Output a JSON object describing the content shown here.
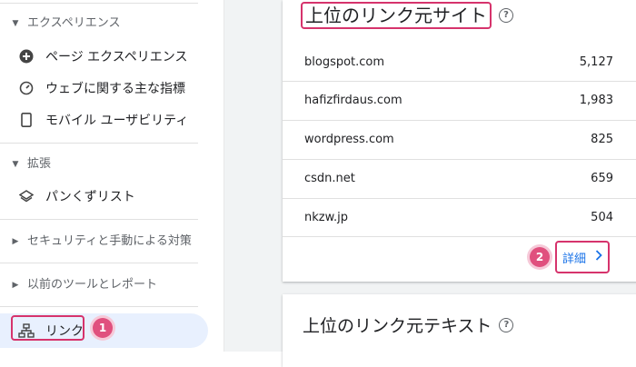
{
  "sidebar": {
    "experience": {
      "header": "エクスペリエンス",
      "items": [
        {
          "label": "ページ エクスペリエンス",
          "icon": "plus-circle-icon"
        },
        {
          "label": "ウェブに関する主な指標",
          "icon": "gauge-icon"
        },
        {
          "label": "モバイル ユーザビリティ",
          "icon": "smartphone-icon"
        }
      ]
    },
    "enhancements": {
      "header": "拡張",
      "items": [
        {
          "label": "パンくずリスト",
          "icon": "layers-icon"
        }
      ]
    },
    "security_header": "セキュリティと手動による対策",
    "legacy_header": "以前のツールとレポート",
    "links": {
      "label": "リンク",
      "icon": "sitemap-icon",
      "badge": "1"
    }
  },
  "main": {
    "top_sites_card": {
      "title": "上位のリンク元サイト",
      "rows": [
        {
          "site": "blogspot.com",
          "value": "5,127"
        },
        {
          "site": "hafizfirdaus.com",
          "value": "1,983"
        },
        {
          "site": "wordpress.com",
          "value": "825"
        },
        {
          "site": "csdn.net",
          "value": "659"
        },
        {
          "site": "nkzw.jp",
          "value": "504"
        }
      ],
      "details_label": "詳細",
      "details_badge": "2"
    },
    "top_text_card": {
      "title": "上位のリンク元テキスト"
    }
  },
  "colors": {
    "highlight": "#d6336c",
    "badge": "#e0507e",
    "link_blue": "#1a73e8",
    "active_bg": "#e8f0fe"
  }
}
